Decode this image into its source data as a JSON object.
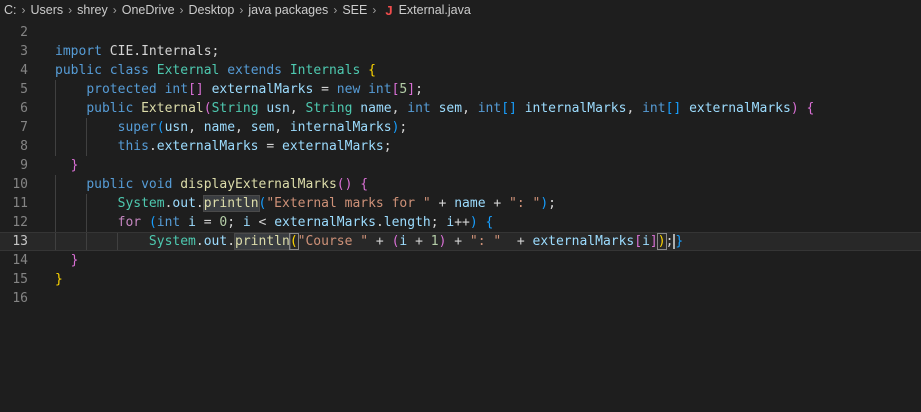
{
  "breadcrumb": {
    "drive": "C:",
    "parts": [
      "Users",
      "shrey",
      "OneDrive",
      "Desktop",
      "java packages",
      "SEE"
    ],
    "file_icon": "J",
    "file_name": "External.java"
  },
  "colors": {
    "keyword": "#569cd6",
    "control": "#c586c0",
    "type": "#4ec9b0",
    "function": "#dcdcaa",
    "variable": "#9cdcfe",
    "string": "#ce9178",
    "number": "#b5cea8"
  },
  "editor": {
    "current_line": 13,
    "lines": [
      {
        "n": "2",
        "tokens": []
      },
      {
        "n": "3",
        "tokens": [
          [
            "kw",
            "import"
          ],
          [
            "pl",
            " CIE.Internals;"
          ]
        ]
      },
      {
        "n": "4",
        "tokens": [
          [
            "kw",
            "public"
          ],
          [
            "pl",
            " "
          ],
          [
            "kw",
            "class"
          ],
          [
            "pl",
            " "
          ],
          [
            "type",
            "External"
          ],
          [
            "pl",
            " "
          ],
          [
            "kw",
            "extends"
          ],
          [
            "pl",
            " "
          ],
          [
            "type",
            "Internals"
          ],
          [
            "pl",
            " "
          ],
          [
            "br1",
            "{"
          ]
        ]
      },
      {
        "n": "5",
        "tokens": [
          [
            "pl",
            "    "
          ],
          [
            "kw",
            "protected"
          ],
          [
            "pl",
            " "
          ],
          [
            "kw",
            "int"
          ],
          [
            "br2",
            "[]"
          ],
          [
            "pl",
            " "
          ],
          [
            "var",
            "externalMarks"
          ],
          [
            "pl",
            " = "
          ],
          [
            "kw",
            "new"
          ],
          [
            "pl",
            " "
          ],
          [
            "kw",
            "int"
          ],
          [
            "br2",
            "["
          ],
          [
            "num",
            "5"
          ],
          [
            "br2",
            "]"
          ],
          [
            "pl",
            ";"
          ]
        ]
      },
      {
        "n": "6",
        "tokens": [
          [
            "pl",
            "    "
          ],
          [
            "kw",
            "public"
          ],
          [
            "pl",
            " "
          ],
          [
            "fn",
            "External"
          ],
          [
            "br2",
            "("
          ],
          [
            "type",
            "String"
          ],
          [
            "pl",
            " "
          ],
          [
            "var",
            "usn"
          ],
          [
            "pl",
            ", "
          ],
          [
            "type",
            "String"
          ],
          [
            "pl",
            " "
          ],
          [
            "var",
            "name"
          ],
          [
            "pl",
            ", "
          ],
          [
            "kw",
            "int"
          ],
          [
            "pl",
            " "
          ],
          [
            "var",
            "sem"
          ],
          [
            "pl",
            ", "
          ],
          [
            "kw",
            "int"
          ],
          [
            "br3",
            "[]"
          ],
          [
            "pl",
            " "
          ],
          [
            "var",
            "internalMarks"
          ],
          [
            "pl",
            ", "
          ],
          [
            "kw",
            "int"
          ],
          [
            "br3",
            "[]"
          ],
          [
            "pl",
            " "
          ],
          [
            "var",
            "externalMarks"
          ],
          [
            "br2",
            ")"
          ],
          [
            "pl",
            " "
          ],
          [
            "br2",
            "{"
          ]
        ]
      },
      {
        "n": "7",
        "tokens": [
          [
            "pl",
            "        "
          ],
          [
            "kw",
            "super"
          ],
          [
            "br3",
            "("
          ],
          [
            "var",
            "usn"
          ],
          [
            "pl",
            ", "
          ],
          [
            "var",
            "name"
          ],
          [
            "pl",
            ", "
          ],
          [
            "var",
            "sem"
          ],
          [
            "pl",
            ", "
          ],
          [
            "var",
            "internalMarks"
          ],
          [
            "br3",
            ")"
          ],
          [
            "pl",
            ";"
          ]
        ]
      },
      {
        "n": "8",
        "tokens": [
          [
            "pl",
            "        "
          ],
          [
            "kw",
            "this"
          ],
          [
            "pl",
            "."
          ],
          [
            "var",
            "externalMarks"
          ],
          [
            "pl",
            " = "
          ],
          [
            "var",
            "externalMarks"
          ],
          [
            "pl",
            ";"
          ]
        ]
      },
      {
        "n": "9",
        "tokens": [
          [
            "pl",
            "  "
          ],
          [
            "br2",
            "}"
          ]
        ]
      },
      {
        "n": "10",
        "tokens": [
          [
            "pl",
            "    "
          ],
          [
            "kw",
            "public"
          ],
          [
            "pl",
            " "
          ],
          [
            "kw",
            "void"
          ],
          [
            "pl",
            " "
          ],
          [
            "fn",
            "displayExternalMarks"
          ],
          [
            "br2",
            "()"
          ],
          [
            "pl",
            " "
          ],
          [
            "br2",
            "{"
          ]
        ]
      },
      {
        "n": "11",
        "tokens": [
          [
            "pl",
            "        "
          ],
          [
            "type",
            "System"
          ],
          [
            "pl",
            "."
          ],
          [
            "var",
            "out"
          ],
          [
            "pl",
            "."
          ],
          [
            "fn hl",
            "println"
          ],
          [
            "br3",
            "("
          ],
          [
            "str",
            "\"External marks for \""
          ],
          [
            "pl",
            " + "
          ],
          [
            "var",
            "name"
          ],
          [
            "pl",
            " + "
          ],
          [
            "str",
            "\": \""
          ],
          [
            "br3",
            ")"
          ],
          [
            "pl",
            ";"
          ]
        ]
      },
      {
        "n": "12",
        "tokens": [
          [
            "pl",
            "        "
          ],
          [
            "ctl",
            "for"
          ],
          [
            "pl",
            " "
          ],
          [
            "br3",
            "("
          ],
          [
            "kw",
            "int"
          ],
          [
            "pl",
            " "
          ],
          [
            "var",
            "i"
          ],
          [
            "pl",
            " = "
          ],
          [
            "num",
            "0"
          ],
          [
            "pl",
            "; "
          ],
          [
            "var",
            "i"
          ],
          [
            "pl",
            " < "
          ],
          [
            "var",
            "externalMarks"
          ],
          [
            "pl",
            "."
          ],
          [
            "var",
            "length"
          ],
          [
            "pl",
            "; "
          ],
          [
            "var",
            "i"
          ],
          [
            "pl",
            "++"
          ],
          [
            "br3",
            ")"
          ],
          [
            "pl",
            " "
          ],
          [
            "br3",
            "{"
          ]
        ]
      },
      {
        "n": "13",
        "tokens": [
          [
            "pl",
            "            "
          ],
          [
            "type",
            "System"
          ],
          [
            "pl",
            "."
          ],
          [
            "var",
            "out"
          ],
          [
            "pl",
            "."
          ],
          [
            "fn hl",
            "println"
          ],
          [
            "br1 match",
            "("
          ],
          [
            "str",
            "\"Course \""
          ],
          [
            "pl",
            " + "
          ],
          [
            "br2",
            "("
          ],
          [
            "var",
            "i"
          ],
          [
            "pl",
            " + "
          ],
          [
            "num",
            "1"
          ],
          [
            "br2",
            ")"
          ],
          [
            "pl",
            " + "
          ],
          [
            "str",
            "\": \""
          ],
          [
            "pl",
            "  + "
          ],
          [
            "var",
            "externalMarks"
          ],
          [
            "br2",
            "["
          ],
          [
            "var",
            "i"
          ],
          [
            "br2",
            "]"
          ],
          [
            "br1 match",
            ")"
          ],
          [
            "pl",
            ";"
          ],
          [
            "cursor",
            ""
          ],
          [
            "br3",
            "}"
          ]
        ]
      },
      {
        "n": "14",
        "tokens": [
          [
            "pl",
            "  "
          ],
          [
            "br2",
            "}"
          ]
        ]
      },
      {
        "n": "15",
        "tokens": [
          [
            "br1",
            "}"
          ]
        ]
      },
      {
        "n": "16",
        "tokens": []
      }
    ]
  }
}
